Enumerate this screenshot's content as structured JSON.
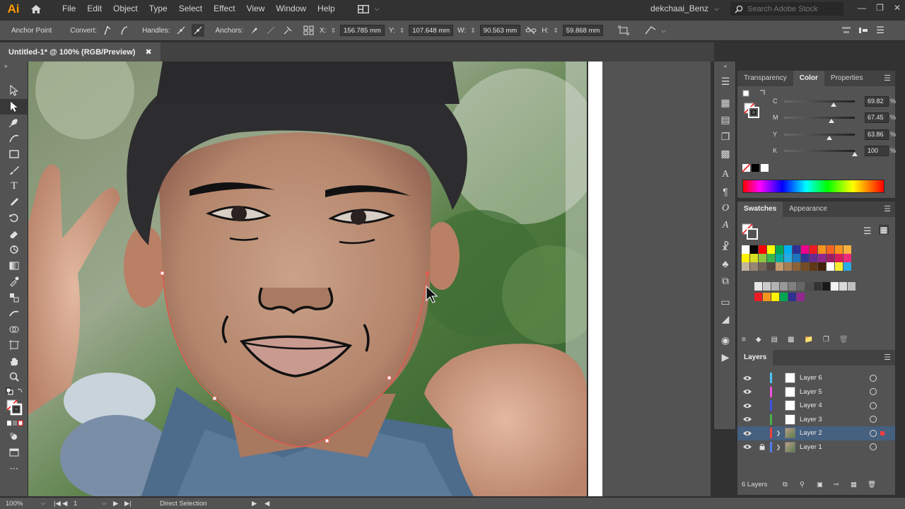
{
  "app": {
    "logo": "Ai",
    "user": "dekchaai_Benz",
    "search_placeholder": "Search Adobe Stock"
  },
  "menu": [
    "File",
    "Edit",
    "Object",
    "Type",
    "Select",
    "Effect",
    "View",
    "Window",
    "Help"
  ],
  "control_bar": {
    "anchor_point": "Anchor Point",
    "convert": "Convert:",
    "handles": "Handles:",
    "anchors": "Anchors:",
    "x_label": "X:",
    "x_value": "156.785 mm",
    "y_label": "Y:",
    "y_value": "107.648 mm",
    "w_label": "W:",
    "w_value": "90.563 mm",
    "h_label": "H:",
    "h_value": "59.868 mm"
  },
  "document": {
    "tab_title": "Untitled-1* @ 100% (RGB/Preview)"
  },
  "color_panel": {
    "tabs": [
      "Transparency",
      "Color",
      "Properties"
    ],
    "active_tab": "Color",
    "channels": [
      {
        "label": "C",
        "value": "69.82",
        "fraction": 0.6982
      },
      {
        "label": "M",
        "value": "67.45",
        "fraction": 0.6745
      },
      {
        "label": "Y",
        "value": "63.86",
        "fraction": 0.6386
      },
      {
        "label": "K",
        "value": "100",
        "fraction": 1.0
      }
    ],
    "unit": "%"
  },
  "swatches_panel": {
    "tabs": [
      "Swatches",
      "Appearance"
    ],
    "active_tab": "Swatches",
    "row1": [
      "#ffffff",
      "#000000",
      "#ff0000",
      "#ffff00",
      "#00a651",
      "#00aeef",
      "#2e3192",
      "#ec008c",
      "#ed1c24",
      "#f7941d",
      "#f26522",
      "#f7941d",
      "#fbb040"
    ],
    "row2": [
      "#fff200",
      "#d7df23",
      "#8dc63f",
      "#39b54a",
      "#00a99d",
      "#27aae1",
      "#1c75bc",
      "#2b3990",
      "#662d91",
      "#92278f",
      "#9e1f63",
      "#da1c5c",
      "#ee2a7b"
    ],
    "row3": [
      "#c2b59b",
      "#998675",
      "#736357",
      "#534741",
      "#c69c6d",
      "#a67c52",
      "#8c6239",
      "#754c24",
      "#603813",
      "#42210b",
      "#ffffff",
      "#f9ed32",
      "#29abe2"
    ],
    "grays": [
      "#e6e6e6",
      "#cccccc",
      "#b3b3b3",
      "#999999",
      "#808080",
      "#666666",
      "#4d4d4d",
      "#333333",
      "#1a1a1a",
      "#f2f2f2",
      "#d9d9d9",
      "#bfbfbf"
    ],
    "group2": [
      "#ed1c24",
      "#f7941d",
      "#fff200",
      "#00a651",
      "#2e3192",
      "#92278f"
    ]
  },
  "layers_panel": {
    "title": "Layers",
    "layers": [
      {
        "name": "Layer 6",
        "color": "#4fc3f7",
        "selected": false,
        "locked": false,
        "expandable": false
      },
      {
        "name": "Layer 5",
        "color": "#ec4fd8",
        "selected": false,
        "locked": false,
        "expandable": false
      },
      {
        "name": "Layer 4",
        "color": "#3f51e8",
        "selected": false,
        "locked": false,
        "expandable": false
      },
      {
        "name": "Layer 3",
        "color": "#4caf50",
        "selected": false,
        "locked": false,
        "expandable": false
      },
      {
        "name": "Layer 2",
        "color": "#f04040",
        "selected": true,
        "locked": false,
        "expandable": true
      },
      {
        "name": "Layer 1",
        "color": "#4f7df0",
        "selected": false,
        "locked": true,
        "expandable": true
      }
    ],
    "count": "6 Layers"
  },
  "status_bar": {
    "zoom": "100%",
    "artboard": "1",
    "tool": "Direct Selection"
  }
}
